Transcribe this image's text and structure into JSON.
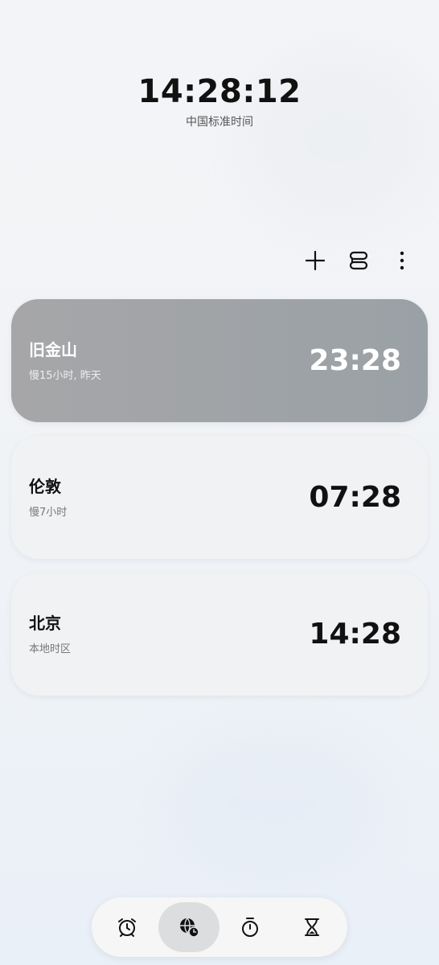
{
  "header": {
    "time": "14:28:12",
    "zone": "中国标准时间"
  },
  "toolbar": {
    "icons": [
      "plus-icon",
      "layout-icon",
      "more-vertical-icon"
    ]
  },
  "cities": [
    {
      "name": "旧金山",
      "offset": "慢15小时, 昨天",
      "time": "23:28",
      "selected": true
    },
    {
      "name": "伦敦",
      "offset": "慢7小时",
      "time": "07:28",
      "selected": false
    },
    {
      "name": "北京",
      "offset": "本地时区",
      "time": "14:28",
      "selected": false
    }
  ],
  "nav": {
    "items": [
      "alarm-icon",
      "world-clock-icon",
      "stopwatch-icon",
      "timer-icon"
    ],
    "active_index": 1
  },
  "colors": {
    "selected_card": "#a3a4a6",
    "card": "#f1f2f4",
    "text": "#111111"
  }
}
